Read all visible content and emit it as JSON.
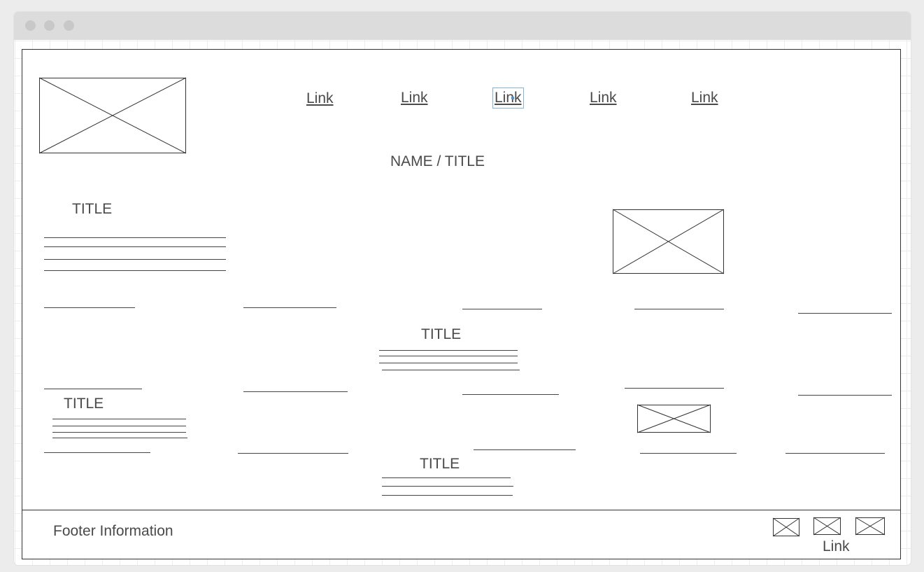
{
  "nav": {
    "links": [
      "Link",
      "Link",
      "Link",
      "Link",
      "Link"
    ]
  },
  "header": {
    "name_title": "NAME / TITLE"
  },
  "sections": {
    "title_left": "TITLE",
    "title_center": "TITLE",
    "title_left_lower": "TITLE",
    "title_center_lower": "TITLE"
  },
  "footer": {
    "info": "Footer Information",
    "link": "Link"
  },
  "colors": {
    "selection": "#7fb2dc",
    "stroke": "#333333"
  }
}
